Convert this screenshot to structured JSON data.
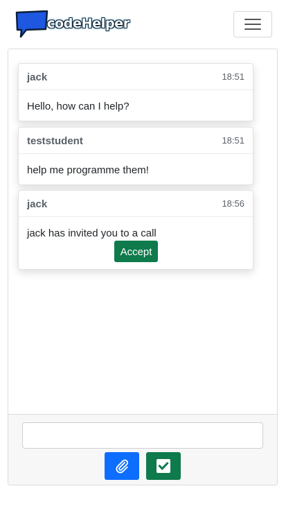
{
  "navbar": {
    "logo_text": "codeHelper",
    "menu_icon": "hamburger-menu-icon"
  },
  "messages": [
    {
      "sender": "jack",
      "time": "18:51",
      "text": "Hello, how can I help?"
    },
    {
      "sender": "teststudent",
      "time": "18:51",
      "text": "help me programme them!"
    },
    {
      "sender": "jack",
      "time": "18:56",
      "text": "jack has invited you to a call",
      "action_label": "Accept"
    }
  ],
  "composer": {
    "input_value": "",
    "input_placeholder": "",
    "attach_icon": "paperclip-icon",
    "send_icon": "checkbox-check-icon"
  },
  "colors": {
    "primary": "#0d6efd",
    "success": "#0f7a4c",
    "logo_blue": "#1e57e0"
  }
}
